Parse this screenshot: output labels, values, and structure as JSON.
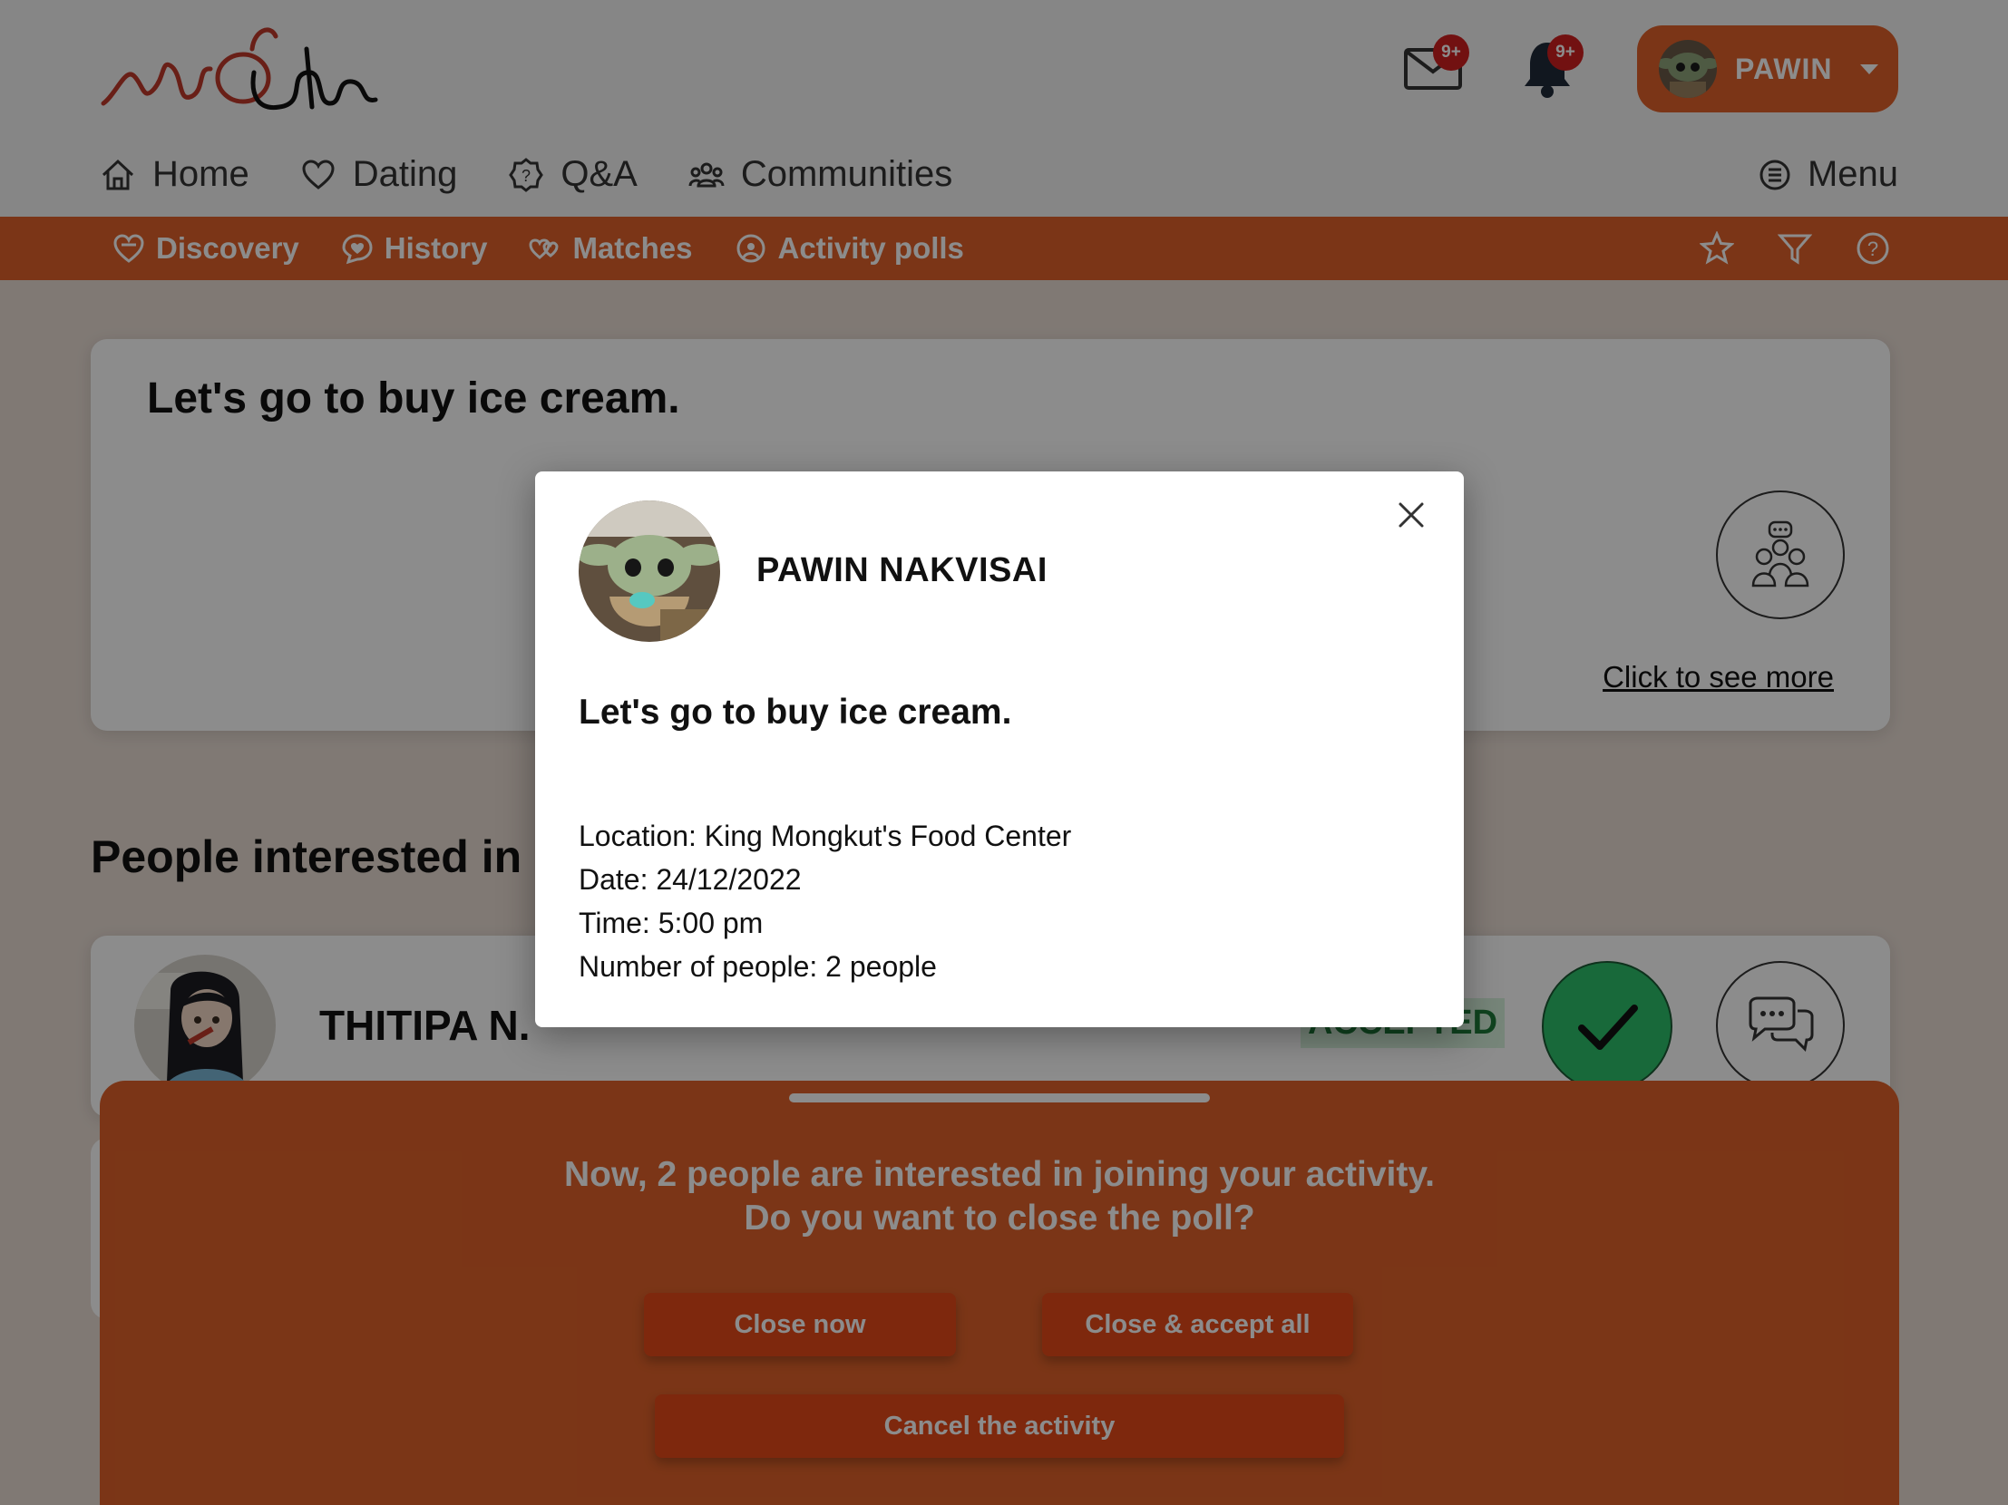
{
  "app": {
    "logo_text": "MoLifes",
    "accent_color": "#e0622a",
    "success_color": "#2dc06a"
  },
  "header": {
    "mail_badge": "9+",
    "bell_badge": "9+",
    "user_name": "PAWIN",
    "mail_icon": "mail-icon",
    "bell_icon": "bell-icon"
  },
  "main_nav": {
    "items": [
      {
        "label": "Home",
        "icon": "home-icon"
      },
      {
        "label": "Dating",
        "icon": "heart-icon"
      },
      {
        "label": "Q&A",
        "icon": "question-badge-icon"
      },
      {
        "label": "Communities",
        "icon": "people-icon"
      }
    ],
    "menu_label": "Menu"
  },
  "sub_nav": {
    "items": [
      {
        "label": "Discovery",
        "icon": "heart-search-icon"
      },
      {
        "label": "History",
        "icon": "heart-chat-icon"
      },
      {
        "label": "Matches",
        "icon": "double-heart-icon"
      },
      {
        "label": "Activity polls",
        "icon": "poll-icon"
      }
    ],
    "tools": [
      "star-icon",
      "filter-icon",
      "help-icon"
    ]
  },
  "poll_card": {
    "title": "Let's go to buy ice cream.",
    "see_more": "Click to see more"
  },
  "people_section": {
    "title_visible": "People interested in",
    "people": [
      {
        "name": "THITIPA N.",
        "status": "ACCEPTED"
      }
    ]
  },
  "bottom_sheet": {
    "message_line1": "Now, 2 people are interested in joining your activity.",
    "message_line2": "Do you want to close the poll?",
    "close_now": "Close now",
    "close_accept_all": "Close & accept all",
    "cancel_activity": "Cancel the activity"
  },
  "modal": {
    "owner_name": "PAWIN NAKVISAI",
    "title": "Let's go to buy ice cream.",
    "location": "Location: King Mongkut's Food Center",
    "date": "Date: 24/12/2022",
    "time": "Time: 5:00 pm",
    "people": "Number of people: 2 people"
  }
}
